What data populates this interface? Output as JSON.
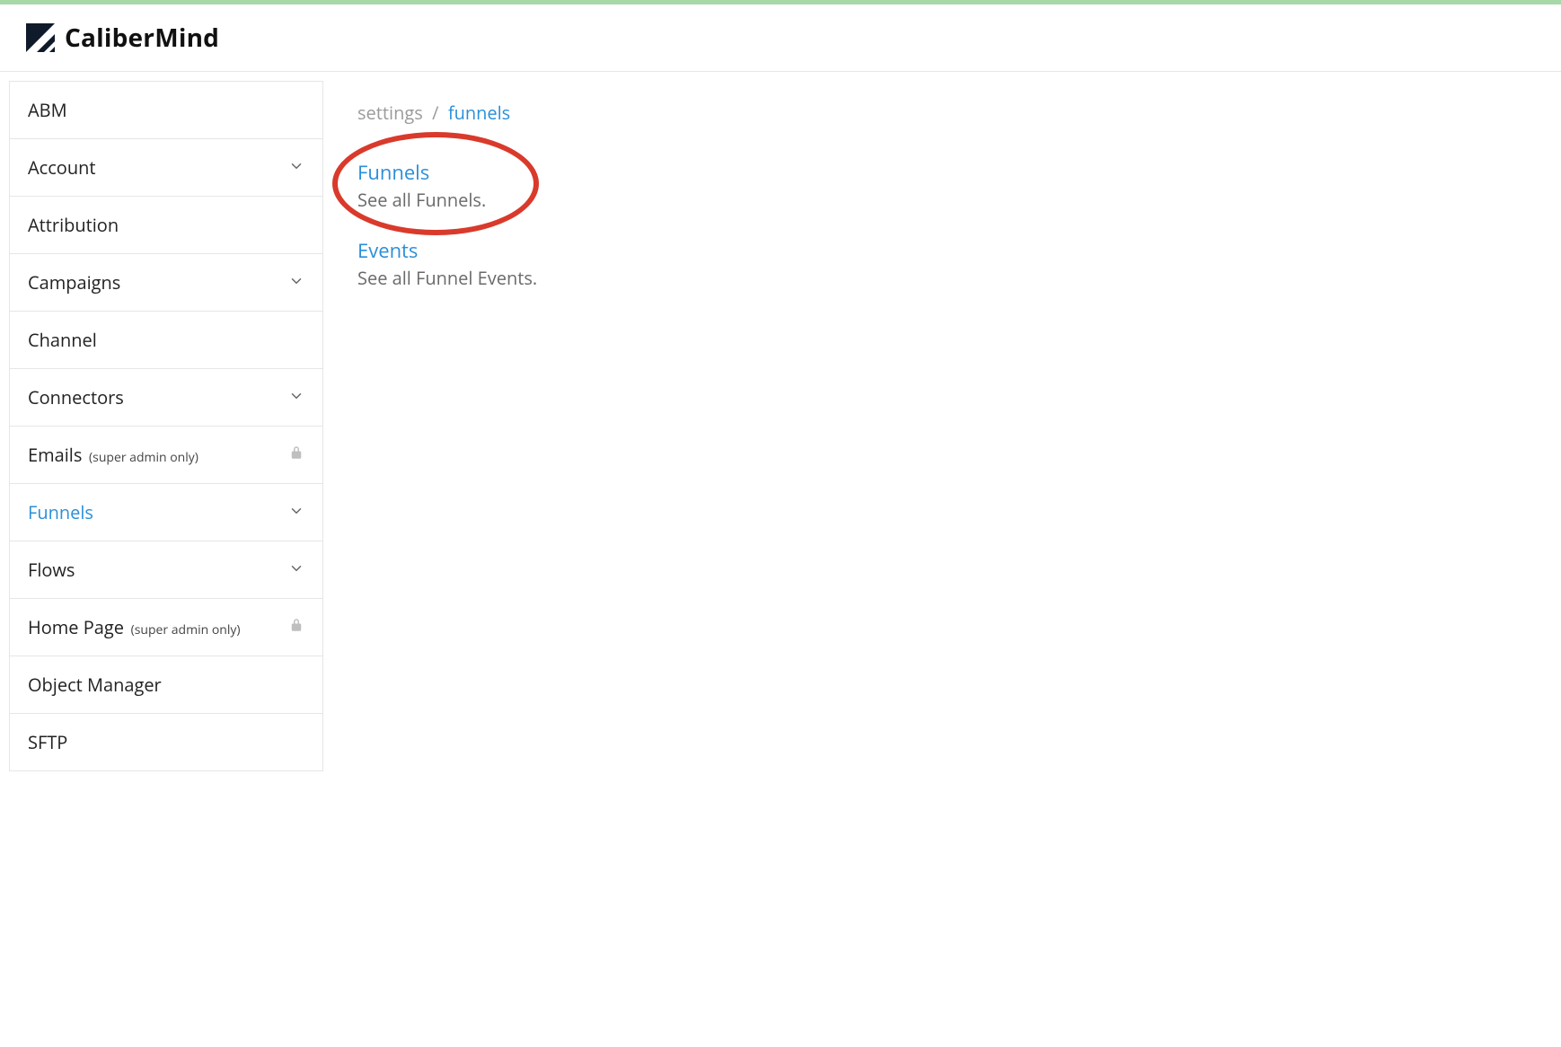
{
  "brand": "CaliberMind",
  "breadcrumb": {
    "root": "settings",
    "sep": "/",
    "current": "funnels"
  },
  "sidebar": {
    "items": [
      {
        "label": "ABM",
        "note": "",
        "expandable": false,
        "locked": false,
        "active": false
      },
      {
        "label": "Account",
        "note": "",
        "expandable": true,
        "locked": false,
        "active": false
      },
      {
        "label": "Attribution",
        "note": "",
        "expandable": false,
        "locked": false,
        "active": false
      },
      {
        "label": "Campaigns",
        "note": "",
        "expandable": true,
        "locked": false,
        "active": false
      },
      {
        "label": "Channel",
        "note": "",
        "expandable": false,
        "locked": false,
        "active": false
      },
      {
        "label": "Connectors",
        "note": "",
        "expandable": true,
        "locked": false,
        "active": false
      },
      {
        "label": "Emails",
        "note": "(super admin only)",
        "expandable": false,
        "locked": true,
        "active": false
      },
      {
        "label": "Funnels",
        "note": "",
        "expandable": true,
        "locked": false,
        "active": true
      },
      {
        "label": "Flows",
        "note": "",
        "expandable": true,
        "locked": false,
        "active": false
      },
      {
        "label": "Home Page",
        "note": "(super admin only)",
        "expandable": false,
        "locked": true,
        "active": false
      },
      {
        "label": "Object Manager",
        "note": "",
        "expandable": false,
        "locked": false,
        "active": false
      },
      {
        "label": "SFTP",
        "note": "",
        "expandable": false,
        "locked": false,
        "active": false
      }
    ]
  },
  "main": {
    "sections": [
      {
        "title": "Funnels",
        "desc": "See all Funnels."
      },
      {
        "title": "Events",
        "desc": "See all Funnel Events."
      }
    ]
  },
  "annotation": {
    "ellipse_on_section": 0
  }
}
